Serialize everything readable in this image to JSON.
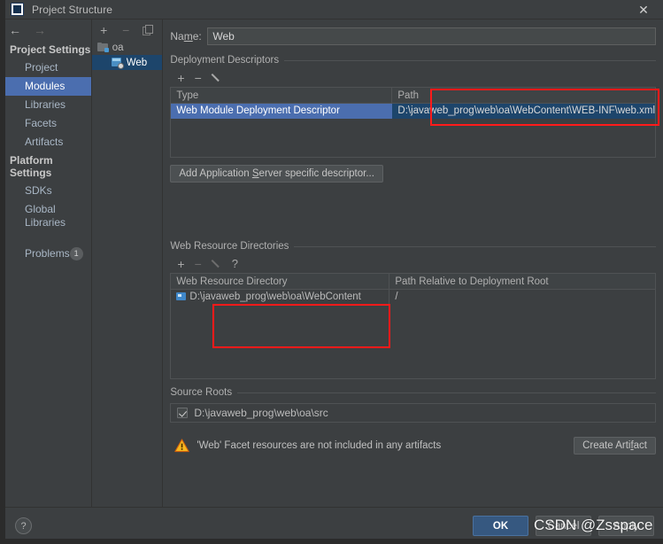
{
  "window": {
    "title": "Project Structure",
    "logo_icon": "intellij-idea-logo",
    "close_icon": "✕"
  },
  "nav": {
    "back_icon": "←",
    "forward_icon": "→"
  },
  "sidebar": {
    "groups": [
      {
        "label": "Project Settings",
        "items": [
          {
            "label": "Project",
            "selected": false
          },
          {
            "label": "Modules",
            "selected": true
          },
          {
            "label": "Libraries",
            "selected": false
          },
          {
            "label": "Facets",
            "selected": false
          },
          {
            "label": "Artifacts",
            "selected": false
          }
        ]
      },
      {
        "label": "Platform Settings",
        "items": [
          {
            "label": "SDKs",
            "selected": false
          },
          {
            "label": "Global Libraries",
            "selected": false
          }
        ]
      }
    ],
    "problems": {
      "label": "Problems",
      "count": "1"
    }
  },
  "tree": {
    "toolbar": {
      "add_icon": "+",
      "remove_icon": "−",
      "copy_icon": "copy-icon"
    },
    "nodes": [
      {
        "label": "oa",
        "icon": "module-folder-icon",
        "level": 1,
        "selected": false
      },
      {
        "label": "Web",
        "icon": "web-facet-icon",
        "level": 2,
        "selected": true
      }
    ]
  },
  "main": {
    "name_label_pre": "Na",
    "name_label_mnemonic": "m",
    "name_label_post": "e:",
    "name_value": "Web",
    "deployment_descriptors": {
      "section_title": "Deployment Descriptors",
      "toolbar": {
        "add_icon": "+",
        "remove_icon": "−",
        "edit_icon": "pencil-icon"
      },
      "columns": [
        "Type",
        "Path"
      ],
      "rows": [
        {
          "type": "Web Module Deployment Descriptor",
          "path": "D:\\javaweb_prog\\web\\oa\\WebContent\\WEB-INF\\web.xml"
        }
      ],
      "add_server_descriptor_pre": "Add Application ",
      "add_server_descriptor_mnemonic": "S",
      "add_server_descriptor_post": "erver specific descriptor..."
    },
    "web_resource_directories": {
      "section_title": "Web Resource Directories",
      "toolbar": {
        "add_icon": "+",
        "remove_icon": "−",
        "edit_icon": "pencil-icon",
        "help_icon": "?"
      },
      "columns": [
        "Web Resource Directory",
        "Path Relative to Deployment Root"
      ],
      "rows": [
        {
          "directory": "D:\\javaweb_prog\\web\\oa\\WebContent",
          "relative_path": "/",
          "icon": "directory-icon"
        }
      ]
    },
    "source_roots": {
      "section_title": "Source Roots",
      "rows": [
        {
          "path": "D:\\javaweb_prog\\web\\oa\\src",
          "checked": true
        }
      ]
    },
    "warning": {
      "icon": "warning-triangle-icon",
      "text": "'Web' Facet resources are not included in any artifacts",
      "action_label_pre": "Create Arti",
      "action_label_mnemonic": "f",
      "action_label_post": "act"
    }
  },
  "footer": {
    "help_icon": "?",
    "buttons": [
      {
        "label": "OK",
        "primary": true
      },
      {
        "label": "Cancel",
        "primary": false
      },
      {
        "label": "Apply",
        "primary": false
      }
    ]
  },
  "watermark": {
    "text": "CSDN @Zsspace"
  },
  "colors": {
    "window_bg": "#3c3f41",
    "selection_focused": "#4b6eaf",
    "selection_blurred": "#1d456b",
    "primary_button": "#365880",
    "annotation": "#ff1a1a",
    "warning": "#f5b820",
    "text": "#bbbbbb"
  }
}
